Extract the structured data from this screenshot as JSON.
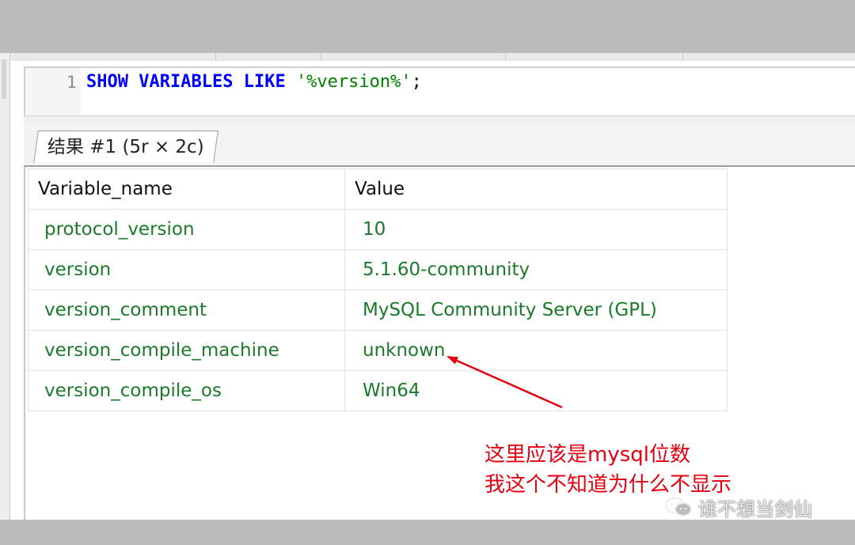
{
  "editor": {
    "line_number": "1",
    "sql": {
      "kw_show": "SHOW",
      "kw_variables": "VARIABLES",
      "kw_like": "LIKE",
      "string_literal": "'%version%'",
      "terminator": ";"
    }
  },
  "result_tab": {
    "label": "结果 #1 (5r × 2c)"
  },
  "grid": {
    "columns": [
      "Variable_name",
      "Value"
    ],
    "rows": [
      [
        "protocol_version",
        "10"
      ],
      [
        "version",
        "5.1.60-community"
      ],
      [
        "version_comment",
        "MySQL Community Server (GPL)"
      ],
      [
        "version_compile_machine",
        "unknown"
      ],
      [
        "version_compile_os",
        "Win64"
      ]
    ],
    "value_color": "#1b7a2a"
  },
  "annotation": {
    "line1": "这里应该是mysql位数",
    "line2": "我这个不知道为什么不显示",
    "color": "#e60012",
    "arrow_points_to": "unknown"
  },
  "watermark": {
    "text": "谁不想当剑仙",
    "icon": "wechat-icon"
  }
}
